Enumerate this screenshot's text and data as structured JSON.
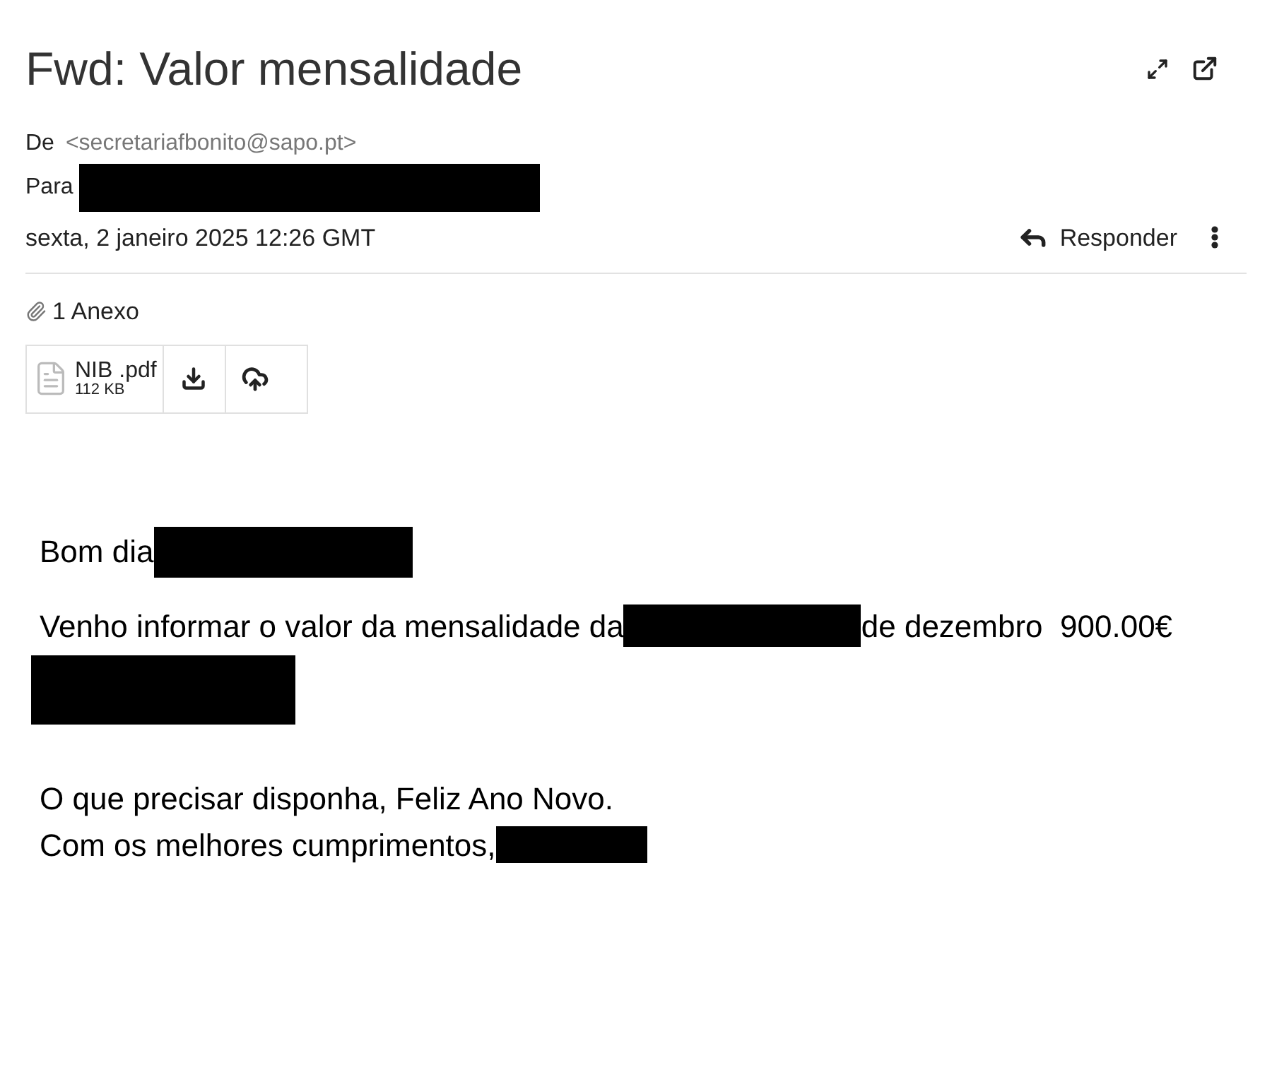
{
  "subject": "Fwd: Valor mensalidade",
  "from": {
    "label": "De",
    "address": "<secretariafbonito@sapo.pt>"
  },
  "to": {
    "label": "Para"
  },
  "date": "sexta, 2 janeiro 2025 12:26 GMT",
  "reply_button": "Responder",
  "attachments": {
    "count_label": "1 Anexo",
    "files": [
      {
        "name": "NIB .pdf",
        "size": "112 KB"
      }
    ]
  },
  "body": [
    {
      "parts": [
        {
          "kind": "text",
          "text": "Bom dia"
        },
        {
          "kind": "redacted"
        }
      ]
    },
    {
      "parts": [
        {
          "kind": "text",
          "text": "Venho informar o valor da mensalidade da"
        },
        {
          "kind": "redacted"
        },
        {
          "kind": "text",
          "text": "de dezembro  900.00€"
        }
      ]
    },
    {
      "parts": [
        {
          "kind": "redacted"
        }
      ]
    },
    {
      "parts": [
        {
          "kind": "text",
          "text": "O que precisar disponha, Feliz Ano Novo."
        }
      ]
    },
    {
      "parts": [
        {
          "kind": "text",
          "text": "Com os melhores cumprimentos,"
        },
        {
          "kind": "redacted"
        }
      ]
    }
  ]
}
